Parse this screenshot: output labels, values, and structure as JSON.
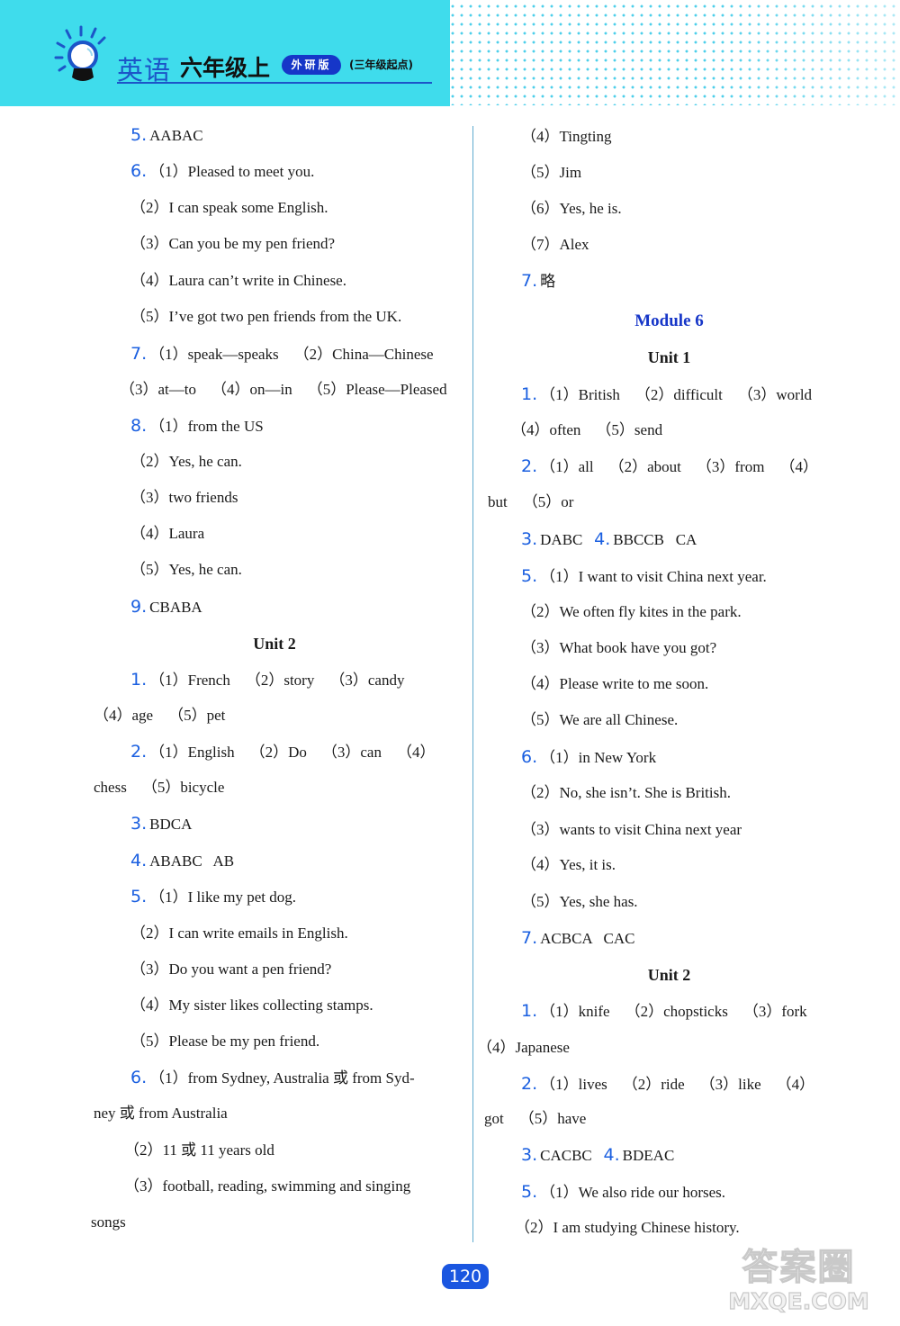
{
  "header": {
    "subject": "英语",
    "grade": "六年级上",
    "edition": "外研版",
    "start_note": "(三年级起点)",
    "icon": "lightbulb-icon",
    "colors": {
      "banner": "#3fdcec",
      "accent_blue": "#1c55c8",
      "badge": "#1636c8"
    }
  },
  "left_column": [
    {
      "num": "5.",
      "text": "AABAC"
    },
    {
      "num": "6.",
      "text": "（1）Pleased to meet you."
    },
    {
      "num": "",
      "text": "（2）I can speak some English."
    },
    {
      "num": "",
      "text": "（3）Can you be my pen friend?"
    },
    {
      "num": "",
      "text": "（4）Laura can’t write in Chinese."
    },
    {
      "num": "",
      "text": "（5）I’ve got two pen friends from the UK."
    },
    {
      "num": "7.",
      "text": "（1）speak—speaks    （2）China—Chinese"
    },
    {
      "num": "",
      "text": "（3）at—to    （4）on—in    （5）Please—Pleased"
    },
    {
      "num": "8.",
      "text": "（1）from the US"
    },
    {
      "num": "",
      "text": "（2）Yes, he can."
    },
    {
      "num": "",
      "text": "（3）two friends"
    },
    {
      "num": "",
      "text": "（4）Laura"
    },
    {
      "num": "",
      "text": "（5）Yes, he can."
    },
    {
      "num": "9.",
      "text": "CBABA"
    },
    {
      "heading": "Unit 2"
    },
    {
      "num": "1.",
      "text": "（1）French    （2）story    （3）candy"
    },
    {
      "num": "",
      "text": "（4）age    （5）pet"
    },
    {
      "num": "2.",
      "text": "（1）English    （2）Do    （3）can    （4）"
    },
    {
      "num": "",
      "text": "chess    （5）bicycle"
    },
    {
      "num": "3.",
      "text": "BDCA"
    },
    {
      "num": "4.",
      "text": "ABABC   AB"
    },
    {
      "num": "5.",
      "text": "（1）I like my pet dog."
    },
    {
      "num": "",
      "text": "（2）I can write emails in English."
    },
    {
      "num": "",
      "text": "（3）Do you want a pen friend?"
    },
    {
      "num": "",
      "text": "（4）My sister likes collecting stamps."
    },
    {
      "num": "",
      "text": "（5）Please be my pen friend."
    },
    {
      "num": "6.",
      "text": "（1）from Sydney, Australia 或 from Syd-"
    },
    {
      "num": "",
      "text": "ney 或 from Australia"
    },
    {
      "num": "",
      "text": "（2）11 或 11 years old"
    },
    {
      "num": "",
      "text": "（3）football, reading, swimming and singing"
    },
    {
      "num": "",
      "text": "songs"
    }
  ],
  "right_column": [
    {
      "num": "",
      "text": "（4）Tingting"
    },
    {
      "num": "",
      "text": "（5）Jim"
    },
    {
      "num": "",
      "text": "（6）Yes, he is."
    },
    {
      "num": "",
      "text": "（7）Alex"
    },
    {
      "num": "7.",
      "text": "略"
    },
    {
      "module": "Module 6"
    },
    {
      "heading": "Unit 1"
    },
    {
      "num": "1.",
      "text": "（1）British    （2）difficult    （3）world"
    },
    {
      "num": "",
      "text": "（4）often    （5）send"
    },
    {
      "num": "2.",
      "text": "（1）all    （2）about    （3）from    （4）"
    },
    {
      "num": "",
      "text": "but    （5）or"
    },
    {
      "num": "3.",
      "text": "DABC",
      "num2": "4.",
      "text2": "BBCCB   CA"
    },
    {
      "num": "5.",
      "text": "（1）I want to visit China next year."
    },
    {
      "num": "",
      "text": "（2）We often fly kites in the park."
    },
    {
      "num": "",
      "text": "（3）What book have you got?"
    },
    {
      "num": "",
      "text": "（4）Please write to me soon."
    },
    {
      "num": "",
      "text": "（5）We are all Chinese."
    },
    {
      "num": "6.",
      "text": "（1）in New York"
    },
    {
      "num": "",
      "text": "（2）No, she isn’t. She is British."
    },
    {
      "num": "",
      "text": "（3）wants to visit China next year"
    },
    {
      "num": "",
      "text": "（4）Yes, it is."
    },
    {
      "num": "",
      "text": "（5）Yes, she has."
    },
    {
      "num": "7.",
      "text": "ACBCA   CAC"
    },
    {
      "heading": "Unit 2"
    },
    {
      "num": "1.",
      "text": "（1）knife    （2）chopsticks    （3）fork"
    },
    {
      "num": "",
      "text": "（4）Japanese"
    },
    {
      "num": "2.",
      "text": "（1）lives    （2）ride    （3）like    （4）"
    },
    {
      "num": "",
      "text": "got    （5）have"
    },
    {
      "num": "3.",
      "text": "CACBC",
      "num2": "4.",
      "text2": "BDEAC"
    },
    {
      "num": "5.",
      "text": "（1）We also ride our horses."
    },
    {
      "num": "",
      "text": "（2）I am studying Chinese history."
    }
  ],
  "footer": {
    "page_number": "120",
    "watermark_cn": "答案圈",
    "watermark_url": "MXQE.COM"
  }
}
